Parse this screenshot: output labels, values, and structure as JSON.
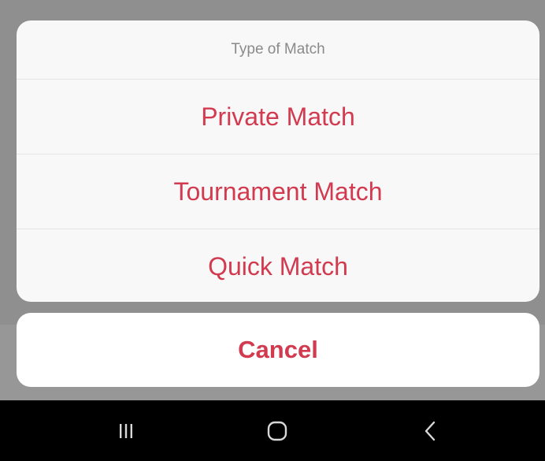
{
  "action_sheet": {
    "title": "Type of Match",
    "options": [
      {
        "label": "Private Match"
      },
      {
        "label": "Tournament Match"
      },
      {
        "label": "Quick Match"
      }
    ],
    "cancel_label": "Cancel"
  },
  "colors": {
    "accent": "#d23a4f",
    "title_text": "#8a8a8a",
    "sheet_background": "#f8f8f8",
    "overlay": "#8f8f8f",
    "navbar_background": "#000000"
  },
  "navigation_bar": {
    "buttons": [
      {
        "icon": "recent-apps-icon"
      },
      {
        "icon": "home-icon"
      },
      {
        "icon": "back-icon"
      }
    ]
  }
}
